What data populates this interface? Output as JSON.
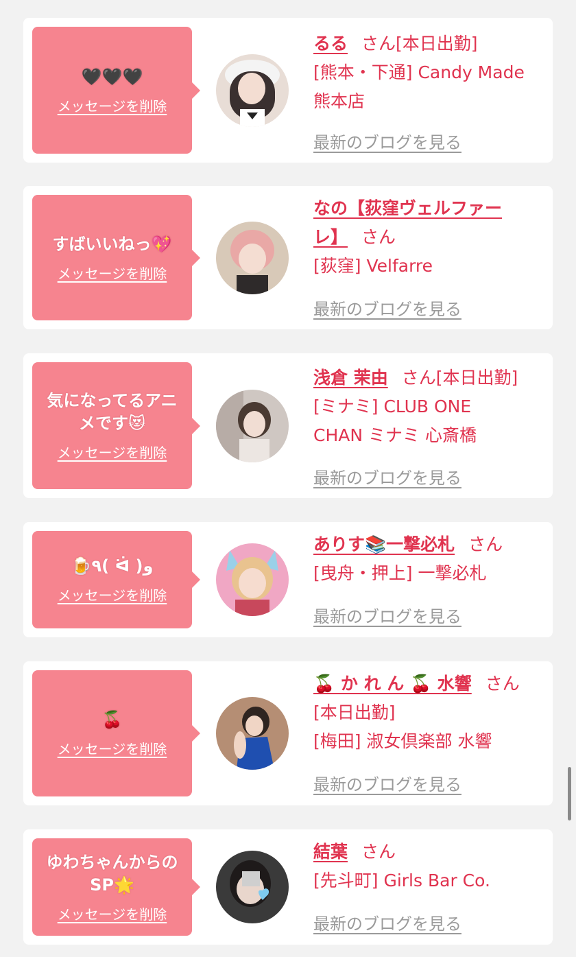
{
  "common": {
    "delete_label": "メッセージを削除",
    "blog_label": "最新のブログを見る",
    "san": "さん"
  },
  "items": [
    {
      "message_lines": [
        "🖤🖤🖤"
      ],
      "name": "るる",
      "status": "[本日出勤]",
      "shop_lines": [
        "[熊本・下通] Candy Made",
        "熊本店"
      ]
    },
    {
      "message_lines": [
        "すばいいねっ💖"
      ],
      "name_lines": [
        "なの【荻窪ヴェルファー",
        "レ】"
      ],
      "status": "",
      "shop_lines": [
        "[荻窪] Velfarre"
      ]
    },
    {
      "message_lines": [
        "気になってるアニ",
        "メです😻"
      ],
      "name": "浅倉 茉由",
      "status": "[本日出勤]",
      "shop_lines": [
        "[ミナミ] CLUB ONE",
        "CHAN ミナミ 心斎橋"
      ]
    },
    {
      "message_lines": [
        "🍺٩( ᐛ )و"
      ],
      "name": "ありす📚一撃必札",
      "status": "",
      "shop_lines": [
        "[曳舟・押上] 一撃必札"
      ]
    },
    {
      "message_lines": [
        "🍒"
      ],
      "name": "🍒 か れ ん 🍒 水響",
      "status": "[本日出勤]",
      "shop_lines": [
        "[梅田] 淑女倶楽部 水響"
      ]
    },
    {
      "message_lines": [
        "ゆわちゃんからの",
        "SP🌟"
      ],
      "name": "結葉",
      "status": "",
      "shop_lines": [
        "[先斗町] Girls Bar Co."
      ]
    }
  ]
}
